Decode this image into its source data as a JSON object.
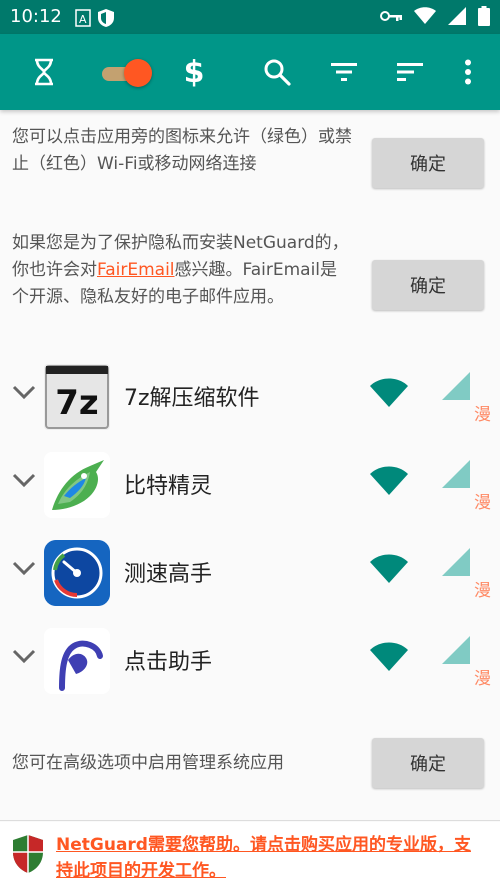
{
  "status_bar": {
    "time": "10:12",
    "left_icons": [
      "text-a-icon",
      "shield-icon"
    ],
    "right_icons": [
      "vpn-key-icon",
      "wifi-icon",
      "signal-icon",
      "battery-icon"
    ]
  },
  "toolbar": {
    "icons": [
      "hourglass-icon",
      "toggle-switch",
      "dollar-icon",
      "search-icon",
      "filter-icon",
      "sort-icon",
      "more-vert-icon"
    ],
    "switch_on": true,
    "dollar": "$"
  },
  "notices": [
    {
      "text": "您可以点击应用旁的图标来允许（绿色）或禁止（红色）Wi-Fi或移动网络连接",
      "button": "确定"
    },
    {
      "text_before": "如果您是为了保护隐私而安装NetGuard的，你也许会对",
      "link": "FairEmail",
      "text_after": "感兴趣。FairEmail是个开源、隐私友好的电子邮件应用。",
      "button": "确定"
    }
  ],
  "apps": [
    {
      "name": "7z解压缩软件",
      "icon": "7z-icon",
      "icon_label": "7z",
      "wifi": "allowed",
      "cell": "allowed",
      "roam": "漫"
    },
    {
      "name": "比特精灵",
      "icon": "bitcomet-icon",
      "wifi": "allowed",
      "cell": "allowed",
      "roam": "漫"
    },
    {
      "name": "测速高手",
      "icon": "speedometer-icon",
      "wifi": "allowed",
      "cell": "allowed",
      "roam": "漫"
    },
    {
      "name": "点击助手",
      "icon": "clicker-icon",
      "wifi": "allowed",
      "cell": "allowed",
      "roam": "漫"
    }
  ],
  "system_notice": {
    "text": "您可在高级选项中启用管理系统应用",
    "button": "确定"
  },
  "support": {
    "text": "NetGuard需要您帮助。请点击购买应用的专业版，支持此项目的开发工作。"
  },
  "colors": {
    "status_bar": "#00796b",
    "toolbar": "#009688",
    "accent": "#ff5722",
    "allowed": "#00897b",
    "roam": "#ff8a65"
  }
}
